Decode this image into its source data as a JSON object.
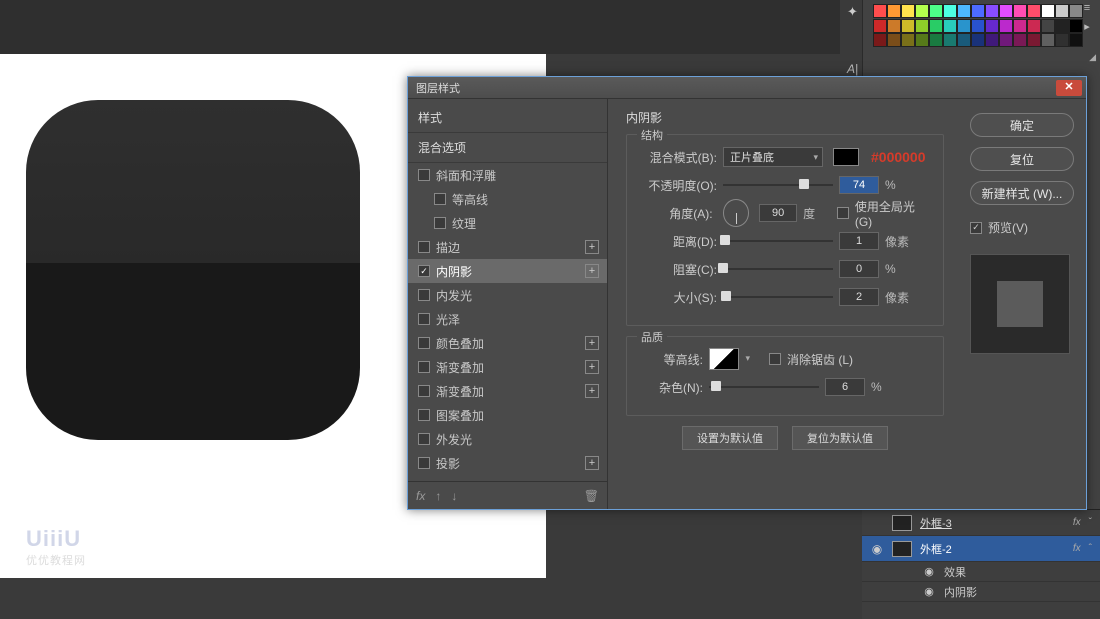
{
  "dialog": {
    "title": "图层样式",
    "styles_header": "样式",
    "blend_header": "混合选项",
    "styles": [
      {
        "label": "斜面和浮雕",
        "checked": false,
        "plus": false,
        "indent": false
      },
      {
        "label": "等高线",
        "checked": false,
        "plus": false,
        "indent": true
      },
      {
        "label": "纹理",
        "checked": false,
        "plus": false,
        "indent": true
      },
      {
        "label": "描边",
        "checked": false,
        "plus": true,
        "indent": false
      },
      {
        "label": "内阴影",
        "checked": true,
        "plus": true,
        "indent": false,
        "selected": true
      },
      {
        "label": "内发光",
        "checked": false,
        "plus": false,
        "indent": false
      },
      {
        "label": "光泽",
        "checked": false,
        "plus": false,
        "indent": false
      },
      {
        "label": "颜色叠加",
        "checked": false,
        "plus": true,
        "indent": false
      },
      {
        "label": "渐变叠加",
        "checked": false,
        "plus": true,
        "indent": false
      },
      {
        "label": "渐变叠加",
        "checked": false,
        "plus": true,
        "indent": false
      },
      {
        "label": "图案叠加",
        "checked": false,
        "plus": false,
        "indent": false
      },
      {
        "label": "外发光",
        "checked": false,
        "plus": false,
        "indent": false
      },
      {
        "label": "投影",
        "checked": false,
        "plus": true,
        "indent": false
      }
    ],
    "section_title": "内阴影",
    "group_structure": "结构",
    "group_quality": "品质",
    "labels": {
      "blend_mode": "混合模式(B):",
      "opacity": "不透明度(O):",
      "angle": "角度(A):",
      "degree": "度",
      "global": "使用全局光 (G)",
      "distance": "距离(D):",
      "choke": "阻塞(C):",
      "size": "大小(S):",
      "contour": "等高线:",
      "antialias": "消除锯齿 (L)",
      "noise": "杂色(N):",
      "px": "像素",
      "pct": "%"
    },
    "values": {
      "blend_mode": "正片叠底",
      "color_hex": "#000000",
      "opacity": 74,
      "angle": 90,
      "global_light": false,
      "distance": 1,
      "choke": 0,
      "size": 2,
      "antialias": false,
      "noise": 6
    },
    "buttons": {
      "ok": "确定",
      "reset": "复位",
      "new_style": "新建样式 (W)...",
      "preview": "预览(V)",
      "make_default": "设置为默认值",
      "reset_default": "复位为默认值"
    },
    "footer_fx": "fx"
  },
  "layers": {
    "rows": [
      {
        "name": "外框-3",
        "fx": "fx",
        "eye": false
      },
      {
        "name": "外框-2",
        "fx": "fx",
        "eye": true,
        "active": true
      }
    ],
    "sub": [
      {
        "eye": true,
        "label": "效果"
      },
      {
        "eye": true,
        "label": "内阴影"
      }
    ]
  },
  "swatch_colors": [
    "#ff4d4d",
    "#ff9933",
    "#ffe24d",
    "#b4ff4d",
    "#4dff88",
    "#4dffe2",
    "#4db8ff",
    "#4d6bff",
    "#884dff",
    "#e24dff",
    "#ff4db4",
    "#ff4d6b",
    "#ffffff",
    "#cccccc",
    "#888888",
    "#cc2929",
    "#cc7a29",
    "#ccbb29",
    "#8fcc29",
    "#29cc66",
    "#29ccbb",
    "#2994cc",
    "#2952cc",
    "#6629cc",
    "#bb29cc",
    "#cc298f",
    "#cc2952",
    "#444444",
    "#222222",
    "#000000",
    "#7a1919",
    "#7a4d19",
    "#7a7019",
    "#567a19",
    "#197a40",
    "#197a70",
    "#195a7a",
    "#19327a",
    "#40197a",
    "#70197a",
    "#7a1956",
    "#7a1932",
    "#606060",
    "#303030",
    "#101010"
  ],
  "watermark": {
    "logo": "UiiiU",
    "sub": "优优教程网"
  },
  "toolhints": {
    "a": "✦",
    "b": "A|"
  }
}
